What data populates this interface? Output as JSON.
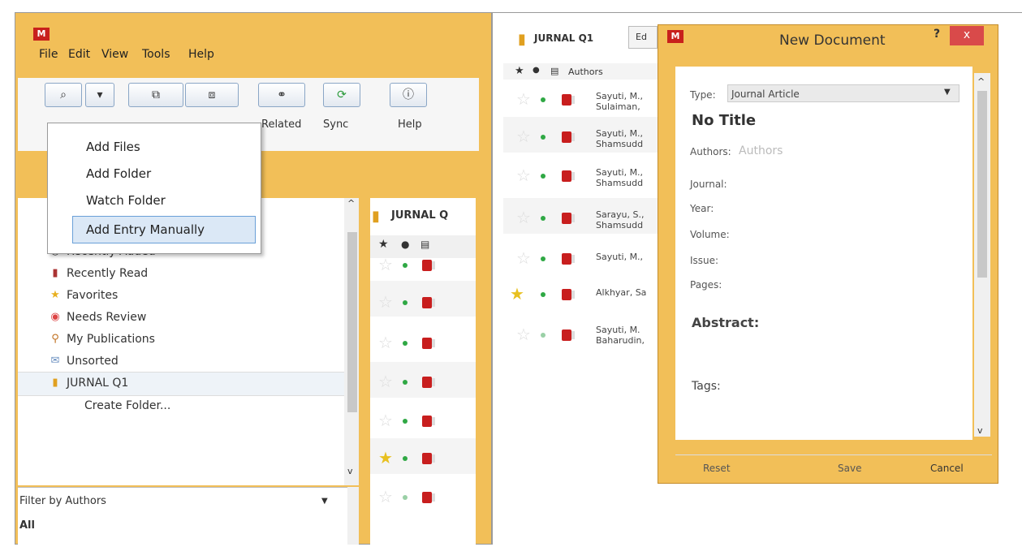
{
  "left": {
    "menu": [
      "File",
      "Edit",
      "View",
      "Tools",
      "Help"
    ],
    "toolbar_labels": {
      "related": "Related",
      "sync": "Sync",
      "help": "Help"
    },
    "dropdown": [
      "Add Files",
      "Add Folder",
      "Watch Folder",
      "Add Entry Manually"
    ],
    "sidebar": [
      "Recently Added",
      "Recently Read",
      "Favorites",
      "Needs Review",
      "My Publications",
      "Unsorted",
      "JURNAL Q1",
      "Create Folder..."
    ],
    "doc_header": "JURNAL Q",
    "filter_label": "Filter by Authors",
    "filter_value": "All"
  },
  "right": {
    "folder": "JURNAL Q1",
    "edit_tab": "Ed",
    "authors_col": "Authors",
    "rows": [
      [
        "Sayuti, M.,",
        "Sulaiman,"
      ],
      [
        "Sayuti, M.,",
        "Shamsudd"
      ],
      [
        "Sayuti, M.,",
        "Shamsudd"
      ],
      [
        "Sarayu, S.,",
        "Shamsudd"
      ],
      [
        "Sayuti, M.,",
        ""
      ],
      [
        "Alkhyar, Sa",
        ""
      ],
      [
        "Sayuti, M.",
        "Baharudin,"
      ]
    ],
    "dialog": {
      "title": "New Document",
      "help": "?",
      "close": "x",
      "type_label": "Type:",
      "type_value": "Journal Article",
      "title_field": "No Title",
      "authors_label": "Authors:",
      "authors_placeholder": "Authors",
      "journal_label": "Journal:",
      "year_label": "Year:",
      "volume_label": "Volume:",
      "issue_label": "Issue:",
      "pages_label": "Pages:",
      "abstract_label": "Abstract:",
      "tags_label": "Tags:",
      "reset": "Reset",
      "save": "Save",
      "cancel": "Cancel"
    }
  }
}
